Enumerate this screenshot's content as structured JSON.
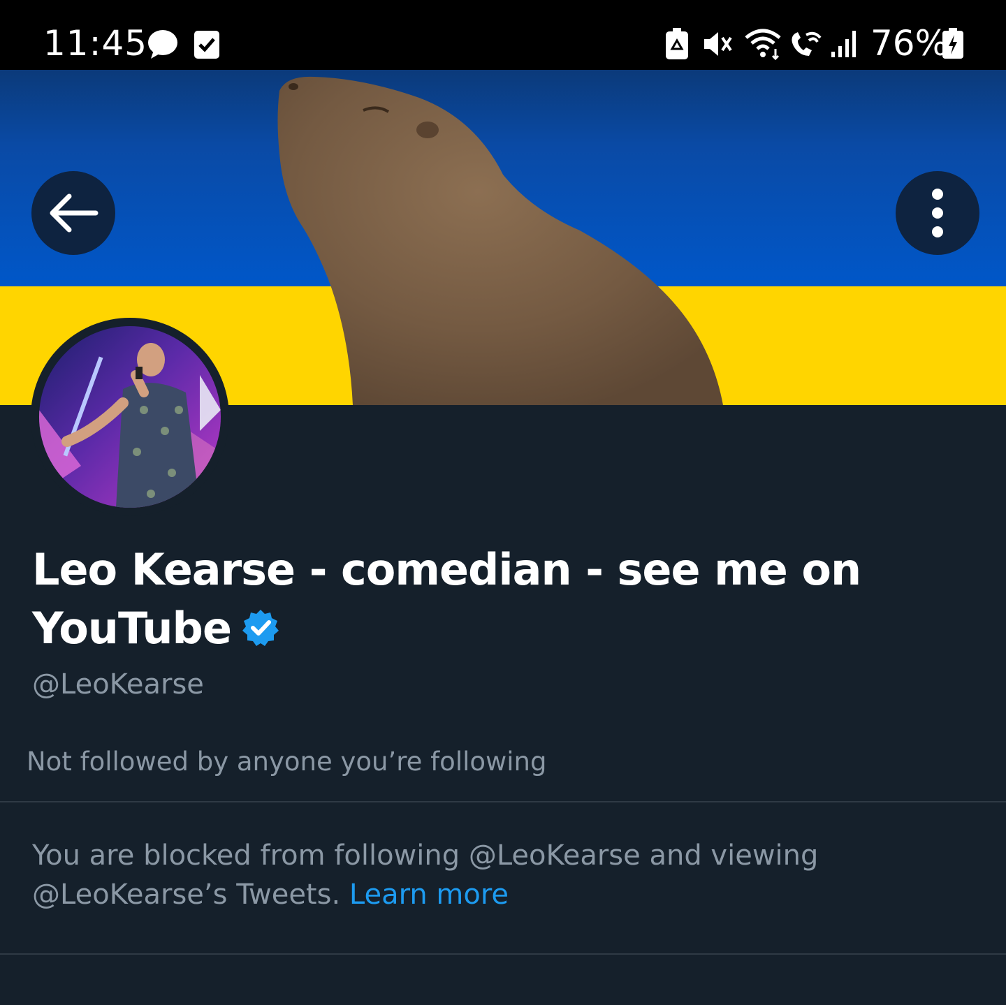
{
  "status_bar": {
    "time": "11:45",
    "battery_percent": "76%",
    "icons": [
      "chat-bubble-icon",
      "checkbox-notification-icon",
      "battery-saver-icon",
      "vibrate-muted-icon",
      "wifi-icon",
      "wifi-calling-icon",
      "signal-icon",
      "battery-charging-icon"
    ]
  },
  "header": {
    "back_icon": "arrow-left-icon",
    "more_icon": "more-vertical-icon"
  },
  "profile": {
    "display_name": "Leo Kearse - comedian - see me on YouTube",
    "verified": true,
    "handle": "@LeoKearse",
    "followers_note": "Not followed by anyone you’re following"
  },
  "blocked": {
    "message": "You are blocked from following @LeoKearse and viewing @LeoKearse’s Tweets.",
    "learn_more": "Learn more"
  },
  "colors": {
    "background": "#15202b",
    "accent": "#1d9bf0",
    "secondary_text": "#8b98a5",
    "flag_blue": "#0057c9",
    "flag_yellow": "#ffd500"
  }
}
